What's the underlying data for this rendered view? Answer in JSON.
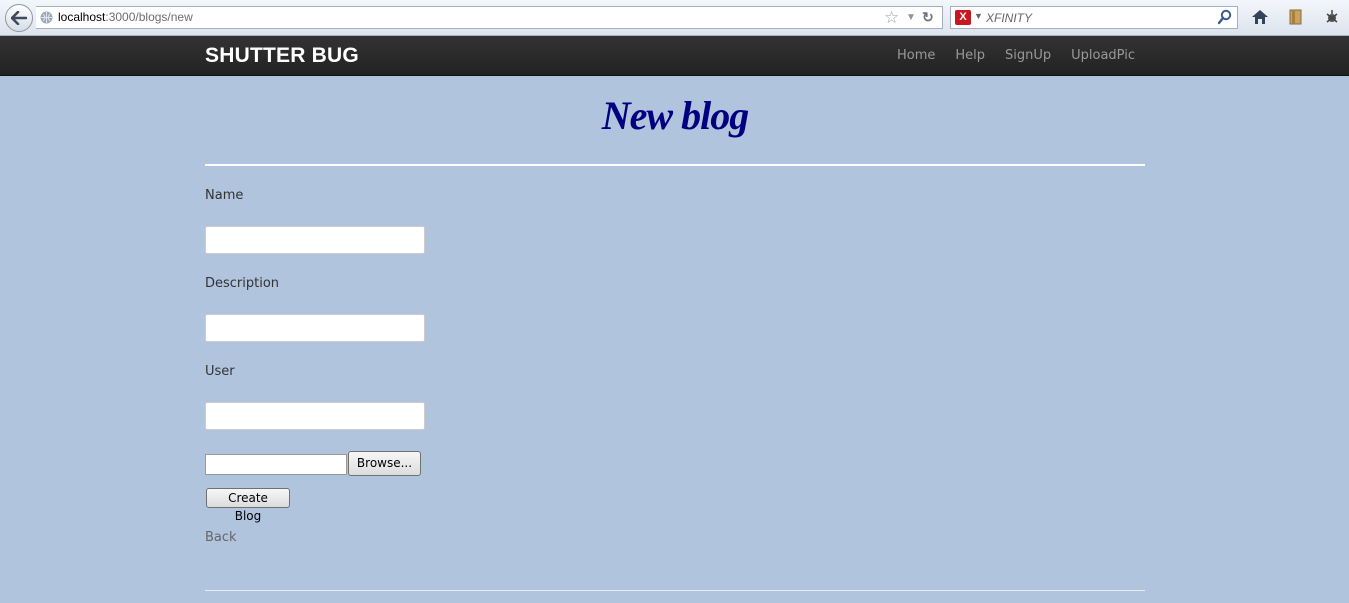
{
  "browser": {
    "url_host": "localhost",
    "url_path": ":3000/blogs/new",
    "search_placeholder": "XFINITY",
    "search_engine_glyph": "X"
  },
  "navbar": {
    "brand": "SHUTTER BUG",
    "links": [
      "Home",
      "Help",
      "SignUp",
      "UploadPic"
    ]
  },
  "page": {
    "title": "New blog",
    "fields": {
      "name_label": "Name",
      "description_label": "Description",
      "user_label": "User"
    },
    "browse_label": "Browse...",
    "submit_label": "Create Blog",
    "back_label": "Back"
  },
  "colors": {
    "page_bg": "#b0c4de",
    "title": "#000080",
    "navbar": "#222222"
  }
}
